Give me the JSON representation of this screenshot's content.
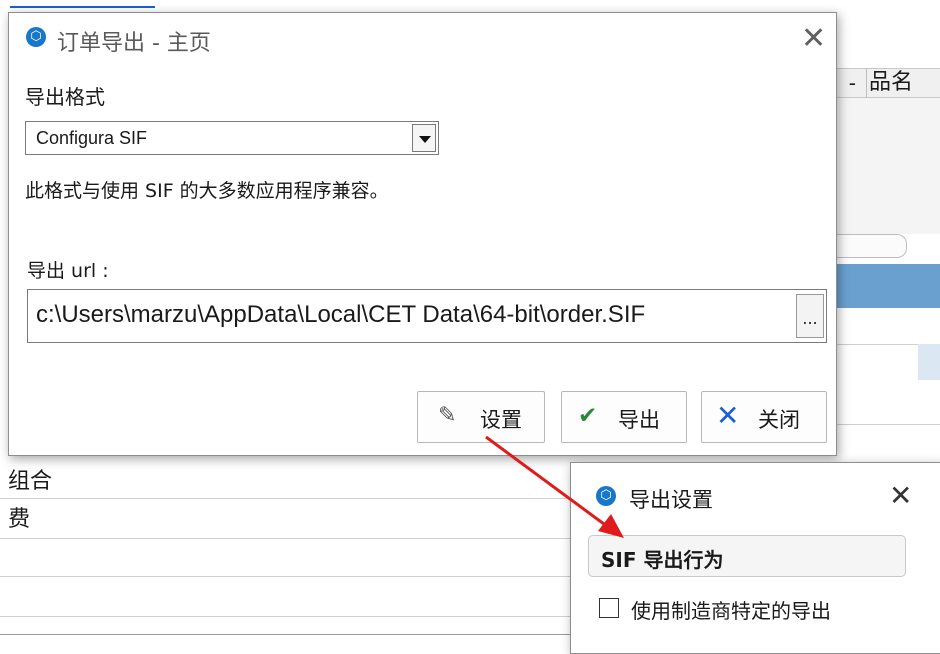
{
  "main_dialog": {
    "title": "订单导出 - 主页",
    "format_label": "导出格式",
    "format_selected": "Configura SIF",
    "format_description": "此格式与使用 SIF 的大多数应用程序兼容。",
    "url_label": "导出 url :",
    "url_value": "c:\\Users\\marzu\\AppData\\Local\\CET Data\\64-bit\\order.SIF",
    "browse_label": "...",
    "buttons": {
      "settings": "设置",
      "export": "导出",
      "close": "关闭"
    }
  },
  "settings_dialog": {
    "title": "导出设置",
    "section_header": "SIF 导出行为",
    "checkbox_label": "使用制造商特定的导出",
    "checkbox_checked": false
  },
  "background": {
    "header_dash": "-",
    "header_col": "品名",
    "row_labels": [
      "组合",
      "费"
    ]
  },
  "icons": {
    "app": "app-logo-icon",
    "close": "close-icon",
    "dropdown": "chevron-down-icon",
    "settings": "pencil-icon",
    "export": "checkmark-icon",
    "cancel": "x-icon"
  },
  "colors": {
    "app_icon": "#1877c9",
    "arrow": "#e01b1b",
    "checkmark": "#2a8a3a",
    "close_x": "#1a5fd0",
    "bg_selection": "#6aa0d0"
  }
}
